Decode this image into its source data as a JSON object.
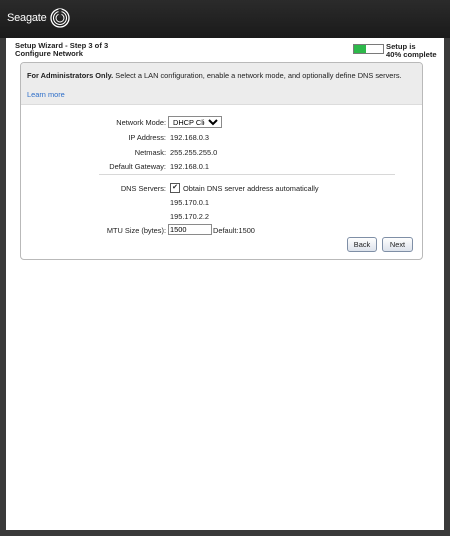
{
  "header": {
    "brand": "Seagate"
  },
  "wizard": {
    "step": "Setup Wizard - Step 3 of 3",
    "page_title": "Configure Network",
    "progress_line1": "Setup is",
    "progress_line2": "40% complete",
    "progress_fraction": 0.4,
    "progress_color": "#2db84a"
  },
  "intro": {
    "bold": "For Administrators Only.",
    "text": " Select a LAN configuration, enable a network mode, and optionally define DNS servers.",
    "learn_more": "Learn more"
  },
  "network": {
    "mode_label": "Network Mode:",
    "mode_value": "DHCP Client",
    "ip_label": "IP Address:",
    "ip_value": "192.168.0.3",
    "netmask_label": "Netmask:",
    "netmask_value": "255.255.255.0",
    "gateway_label": "Default Gateway:",
    "gateway_value": "192.168.0.1"
  },
  "dns": {
    "label": "DNS Servers:",
    "auto_label": "Obtain DNS server address automatically",
    "auto_checked": true,
    "server1": "195.170.0.1",
    "server2": "195.170.2.2"
  },
  "mtu": {
    "label": "MTU Size (bytes):",
    "value": "1500",
    "default_text": "Default:1500"
  },
  "buttons": {
    "back": "Back",
    "next": "Next"
  }
}
